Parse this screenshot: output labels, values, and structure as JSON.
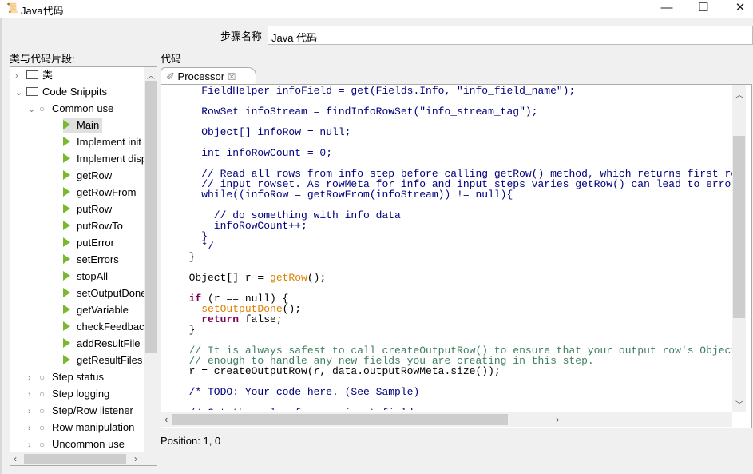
{
  "window": {
    "title": "Java代码",
    "minimize": "—",
    "maximize": "☐",
    "close": "✕"
  },
  "step_name": {
    "label": "步骤名称",
    "value": "Java 代码"
  },
  "left_panel": {
    "label": "类与代码片段:"
  },
  "tree": [
    {
      "label": "类",
      "level": 0,
      "kind": "folder",
      "expand": "collapsed"
    },
    {
      "label": "Code Snippits",
      "level": 0,
      "kind": "folder",
      "expand": "expanded"
    },
    {
      "label": "Common use",
      "level": 1,
      "kind": "clip",
      "expand": "expanded"
    },
    {
      "label": "Main",
      "level": 2,
      "kind": "play",
      "selected": true
    },
    {
      "label": "Implement init",
      "level": 2,
      "kind": "play"
    },
    {
      "label": "Implement dispose",
      "level": 2,
      "kind": "play"
    },
    {
      "label": "getRow",
      "level": 2,
      "kind": "play"
    },
    {
      "label": "getRowFrom",
      "level": 2,
      "kind": "play"
    },
    {
      "label": "putRow",
      "level": 2,
      "kind": "play"
    },
    {
      "label": "putRowTo",
      "level": 2,
      "kind": "play"
    },
    {
      "label": "putError",
      "level": 2,
      "kind": "play"
    },
    {
      "label": "setErrors",
      "level": 2,
      "kind": "play"
    },
    {
      "label": "stopAll",
      "level": 2,
      "kind": "play"
    },
    {
      "label": "setOutputDone",
      "level": 2,
      "kind": "play"
    },
    {
      "label": "getVariable",
      "level": 2,
      "kind": "play"
    },
    {
      "label": "checkFeedback",
      "level": 2,
      "kind": "play"
    },
    {
      "label": "addResultFile",
      "level": 2,
      "kind": "play"
    },
    {
      "label": "getResultFiles",
      "level": 2,
      "kind": "play"
    },
    {
      "label": "Step status",
      "level": 1,
      "kind": "clip",
      "expand": "collapsed"
    },
    {
      "label": "Step logging",
      "level": 1,
      "kind": "clip",
      "expand": "collapsed"
    },
    {
      "label": "Step/Row listener",
      "level": 1,
      "kind": "clip",
      "expand": "collapsed"
    },
    {
      "label": "Row manipulation",
      "level": 1,
      "kind": "clip",
      "expand": "collapsed"
    },
    {
      "label": "Uncommon use",
      "level": 1,
      "kind": "clip",
      "expand": "collapsed"
    }
  ],
  "code_panel": {
    "label": "代码",
    "tab": "Processor",
    "tab_close": "☒"
  },
  "code_lines": [
    [
      [
        "bl",
        "    FieldHelper infoField = get(Fields.Info, \"info_field_name\");"
      ]
    ],
    [],
    [
      [
        "bl",
        "    RowSet infoStream = findInfoRowSet(\"info_stream_tag\");"
      ]
    ],
    [],
    [
      [
        "bl",
        "    Object[] infoRow = null;"
      ]
    ],
    [],
    [
      [
        "bl",
        "    int infoRowCount = 0;"
      ]
    ],
    [],
    [
      [
        "bl",
        "    // Read all rows from info step before calling getRow() method, which returns first row from any"
      ]
    ],
    [
      [
        "bl",
        "    // input rowset. As rowMeta for info and input steps varies getRow() can lead to errors."
      ]
    ],
    [
      [
        "bl",
        "    while((infoRow = getRowFrom(infoStream)) != null){"
      ]
    ],
    [],
    [
      [
        "bl",
        "      // do something with info data"
      ]
    ],
    [
      [
        "bl",
        "      infoRowCount++;"
      ]
    ],
    [
      [
        "bl",
        "    }"
      ]
    ],
    [
      [
        "bl",
        "    */"
      ]
    ],
    [
      [
        "pl",
        "  }"
      ]
    ],
    [],
    [
      [
        "pl",
        "  Object[] r = "
      ],
      [
        "fn",
        "getRow"
      ],
      [
        "pl",
        "();"
      ]
    ],
    [],
    [
      [
        "pl",
        "  "
      ],
      [
        "kw",
        "if"
      ],
      [
        "pl",
        " (r == null) {"
      ]
    ],
    [
      [
        "pl",
        "    "
      ],
      [
        "fn",
        "setOutputDone"
      ],
      [
        "pl",
        "();"
      ]
    ],
    [
      [
        "pl",
        "    "
      ],
      [
        "kw",
        "return"
      ],
      [
        "pl",
        " false;"
      ]
    ],
    [
      [
        "pl",
        "  }"
      ]
    ],
    [],
    [
      [
        "cm",
        "  // It is always safest to call createOutputRow() to ensure that your output row's Object[] is large"
      ]
    ],
    [
      [
        "cm",
        "  // enough to handle any new fields you are creating in this step."
      ]
    ],
    [
      [
        "pl",
        "  r = createOutputRow(r, data.outputRowMeta.size());"
      ]
    ],
    [],
    [
      [
        "bl",
        "  /* TODO: Your code here. (See Sample)"
      ]
    ],
    [],
    [
      [
        "bl",
        "  // Get the value from an input field"
      ]
    ]
  ],
  "status": "Position: 1, 0"
}
